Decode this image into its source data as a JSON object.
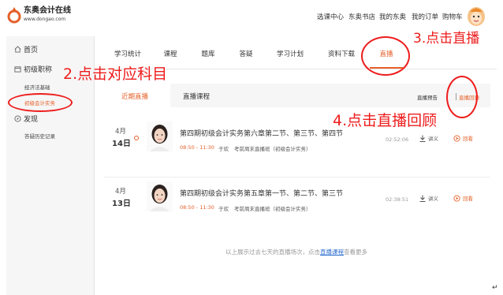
{
  "header": {
    "logo_name": "东奥会计在线",
    "logo_url": "www.dongao.com",
    "nav": [
      "选课中心",
      "东奥书店",
      "我的东奥",
      "我的订单",
      "购物车"
    ],
    "colors": {
      "accent": "#e5602a",
      "annotation": "#ee1c1c"
    }
  },
  "sidebar": {
    "home": "首页",
    "level": "初级职称",
    "level_items": [
      "经济法基础",
      "初级会计实务"
    ],
    "active_item": "初级会计实务",
    "discover": "发现",
    "discover_items": [
      "答疑历史记录"
    ]
  },
  "tabs": {
    "items": [
      "学习统计",
      "课程",
      "题库",
      "答疑",
      "学习计划",
      "资料下载",
      "直播"
    ],
    "active": "直播"
  },
  "subtabs": {
    "recent": "近期直播",
    "courses": "直播课程",
    "preview": "直播预告",
    "sep": "|",
    "replay": "直播回顾"
  },
  "sessions": [
    {
      "month": "4月",
      "day": "14日",
      "title": "第四期初级会计实务第六章第二节、第三节、第四节",
      "time": "08:50 - 11:30",
      "teacher": "于欢",
      "class_name": "考前周末直播班（初级会计实务）",
      "duration": "02:52:06",
      "download": "讲义",
      "replay": "回看"
    },
    {
      "month": "4月",
      "day": "13日",
      "title": "第四期初级会计实务第五章第一节、第二节、第三节",
      "time": "08:50 - 11:30",
      "teacher": "于欢",
      "class_name": "考前周末直播班（初级会计实务）",
      "duration": "02:38:51",
      "download": "讲义",
      "replay": "回看"
    }
  ],
  "footer": {
    "prefix": "以上展示过去七天的直播场次，点击",
    "link": "直播课程",
    "suffix": "查看更多"
  },
  "annotations": {
    "step2": "2.点击对应科目",
    "step3": "3.点击直播",
    "step4": "4.点击直播回顾"
  },
  "corner_mark": "↵"
}
